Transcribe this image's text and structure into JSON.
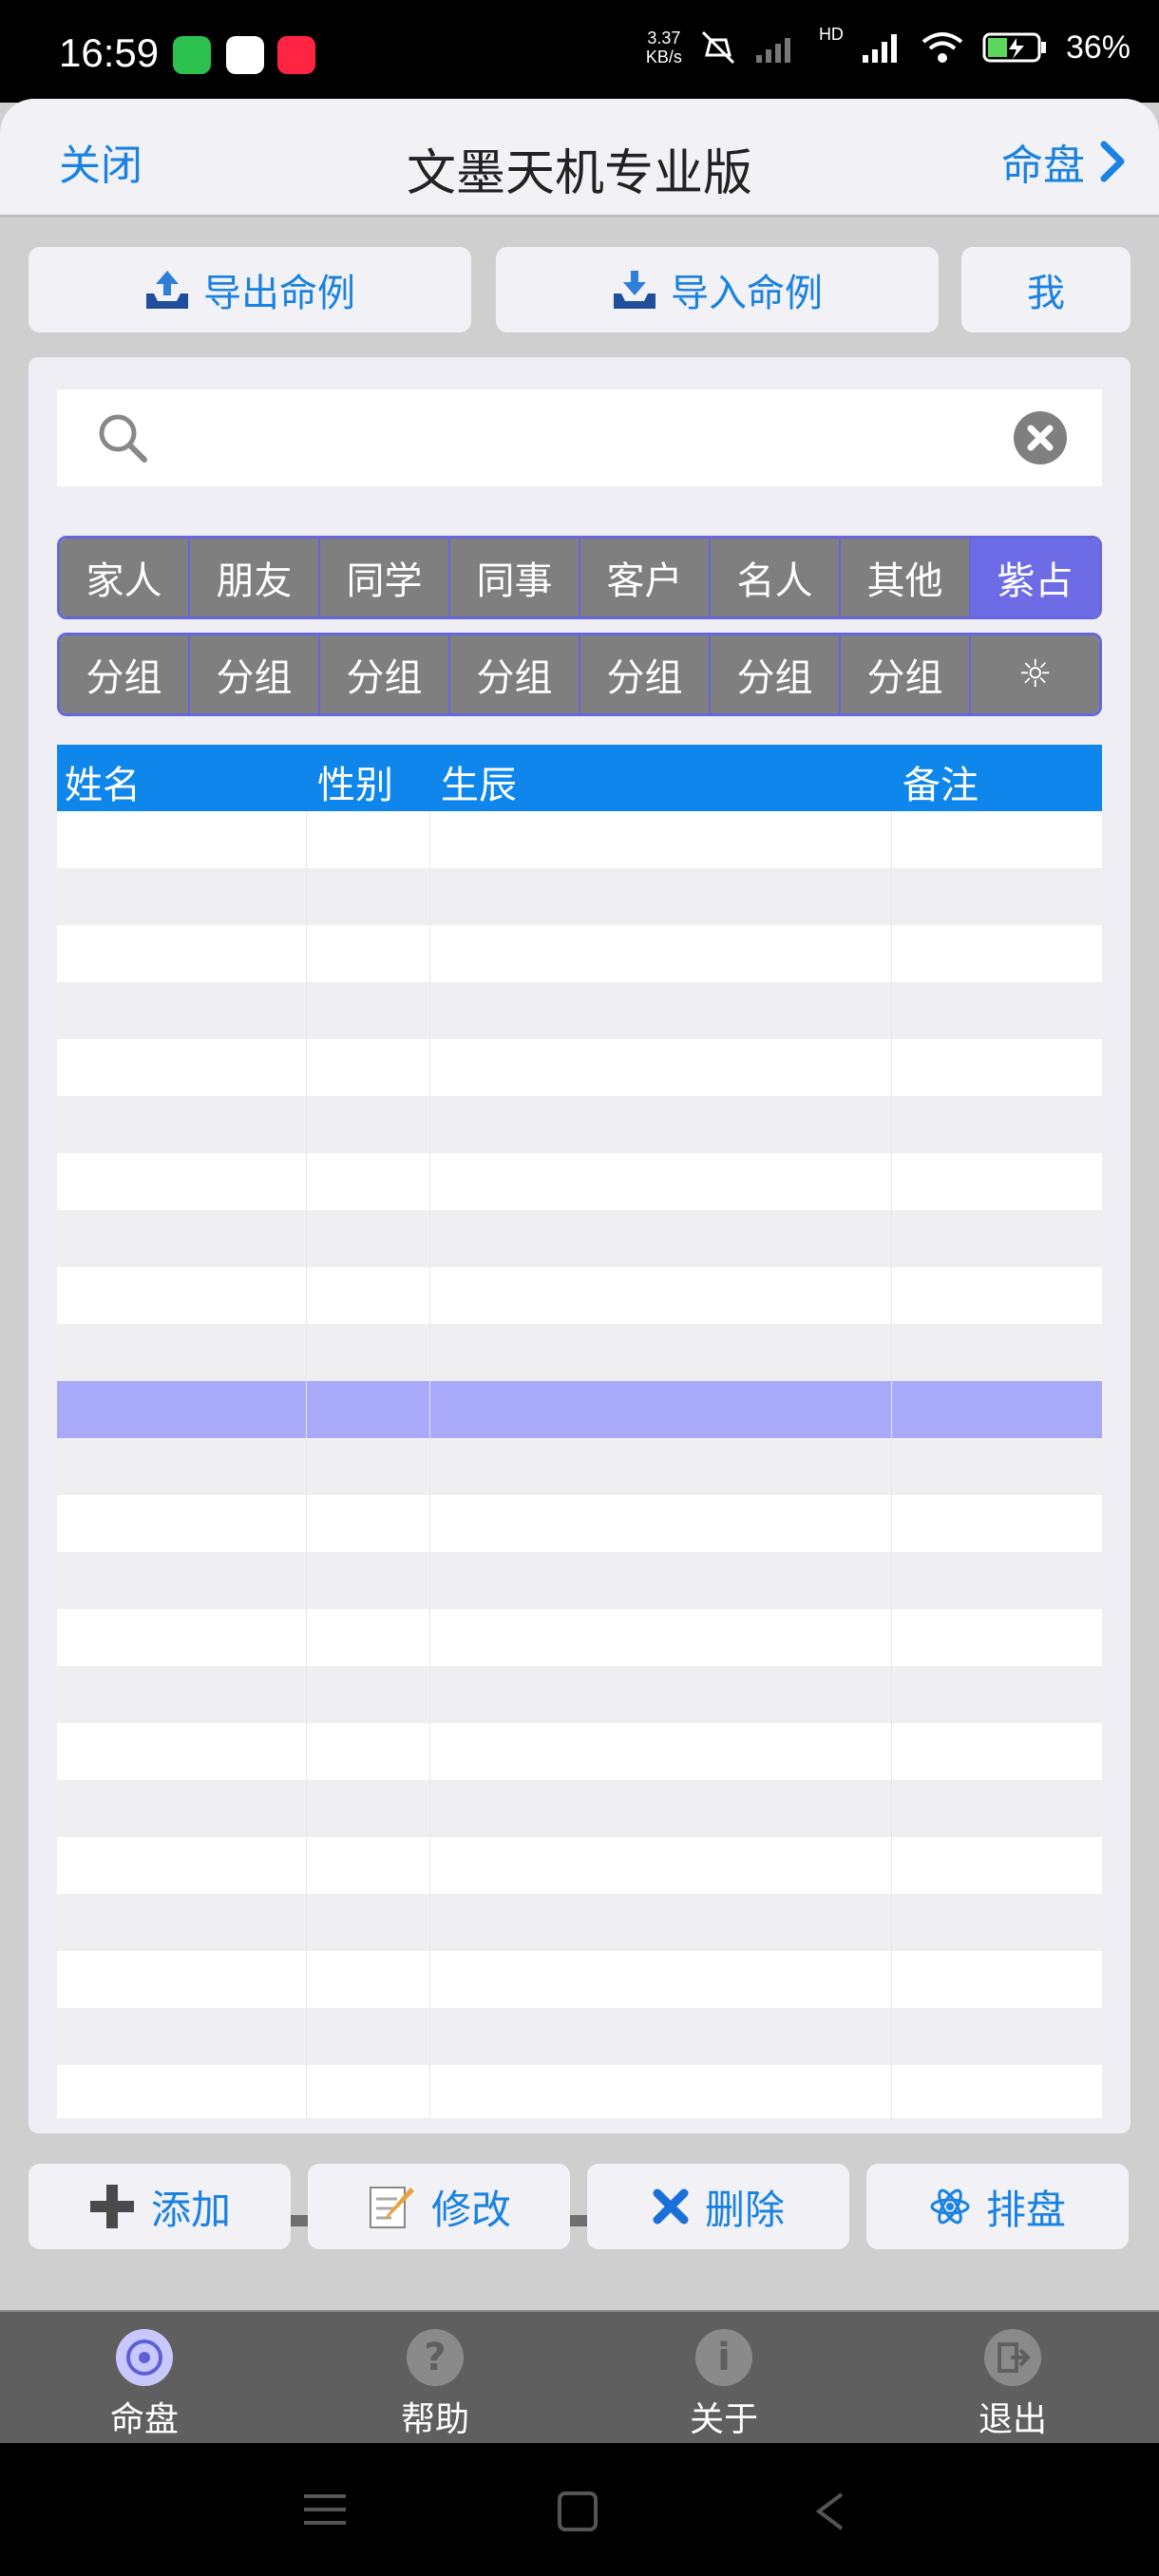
{
  "status": {
    "time": "16:59",
    "net_speed": "3.37",
    "net_unit": "KB/s",
    "hd": "HD",
    "battery": "36%"
  },
  "nav": {
    "close": "关闭",
    "title": "文墨天机专业版",
    "right": "命盘"
  },
  "top_buttons": {
    "export": "导出命例",
    "import": "导入命例",
    "me": "我"
  },
  "categories": [
    "家人",
    "朋友",
    "同学",
    "同事",
    "客户",
    "名人",
    "其他",
    "紫占"
  ],
  "active_category": "紫占",
  "groups": [
    "分组",
    "分组",
    "分组",
    "分组",
    "分组",
    "分组",
    "分组",
    "☼"
  ],
  "table": {
    "headers": [
      "姓名",
      "性别",
      "生辰",
      "备注"
    ],
    "selected_row": 10
  },
  "actions": {
    "add": "添加",
    "edit": "修改",
    "delete": "删除",
    "chart": "排盘"
  },
  "tabs": [
    "命盘",
    "帮助",
    "关于",
    "退出"
  ],
  "colors": {
    "accent": "#1a82e0",
    "header_blue": "#0f86ec",
    "chip_gray": "#7f7f7f",
    "chip_active": "#6d6ce6",
    "selected_row": "#a9a9fa"
  }
}
